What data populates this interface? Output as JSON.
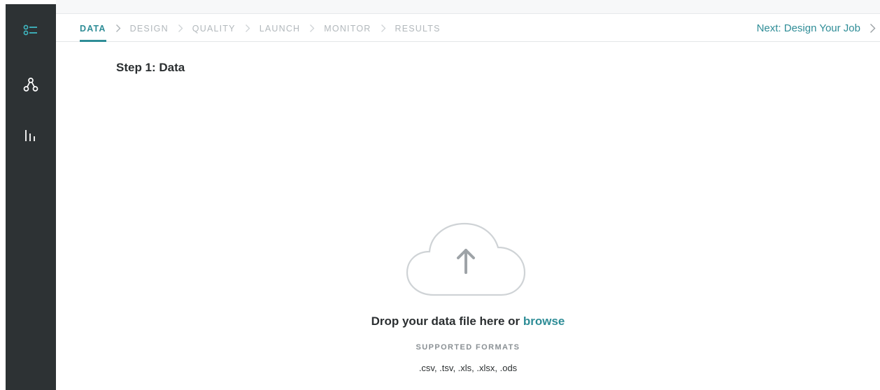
{
  "sidebar": {
    "icons": [
      "list-icon",
      "workflow-icon",
      "bar-chart-icon"
    ]
  },
  "steps": [
    {
      "label": "DATA",
      "active": true
    },
    {
      "label": "DESIGN",
      "active": false
    },
    {
      "label": "QUALITY",
      "active": false
    },
    {
      "label": "LAUNCH",
      "active": false
    },
    {
      "label": "MONITOR",
      "active": false
    },
    {
      "label": "RESULTS",
      "active": false
    }
  ],
  "next_link": "Next: Design Your Job",
  "page_title": "Step 1: Data",
  "upload": {
    "icon": "cloud-upload-icon",
    "prompt": "Drop your data file here or",
    "browse": "browse",
    "formats_label": "SUPPORTED FORMATS",
    "formats": ".csv, .tsv, .xls, .xlsx, .ods"
  },
  "colors": {
    "accent": "#2f8d97",
    "sidebar_bg": "#2d3234",
    "inactive_step": "#b2b8bc"
  }
}
